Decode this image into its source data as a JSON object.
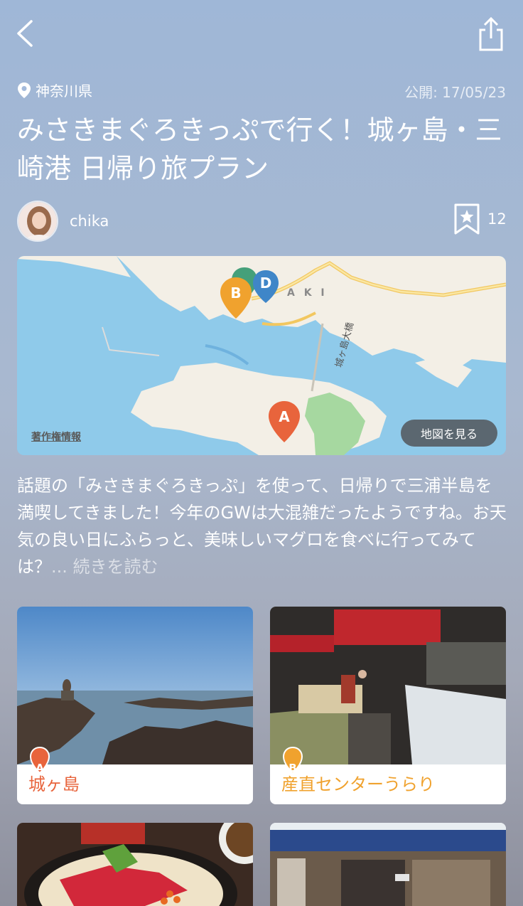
{
  "header": {
    "back_icon": "chevron-left-icon",
    "share_icon": "share-icon"
  },
  "article": {
    "prefecture": "神奈川県",
    "published": "公開: 17/05/23",
    "title": "みさきまぐろきっぷで行く！城ヶ島・三崎港 日帰り旅プラン",
    "author_name": "chika",
    "bookmark_count": "12",
    "description": "話題の「みさきまぐろきっぷ」を使って、日帰りで三浦半島を満喫してきました！今年のGWは大混雑だったようですね。お天気の良い日にふらっと、美味しいマグロを食べに行ってみては？",
    "ellipsis": "... ",
    "read_more": "続きを読む"
  },
  "map": {
    "copyright": "著作権情報",
    "view_map": "地図を見る",
    "label_aki": "A K I",
    "bridge_label": "城ヶ島大橋",
    "pins": [
      {
        "letter": "A",
        "color": "#e8643c"
      },
      {
        "letter": "B",
        "color": "#f0a22e"
      },
      {
        "letter": "D",
        "color": "#3f86c8"
      }
    ]
  },
  "spots": [
    {
      "letter": "A",
      "name": "城ヶ島",
      "color": "#e8643c"
    },
    {
      "letter": "B",
      "name": "産直センターうらり",
      "color": "#f0a22e"
    }
  ]
}
